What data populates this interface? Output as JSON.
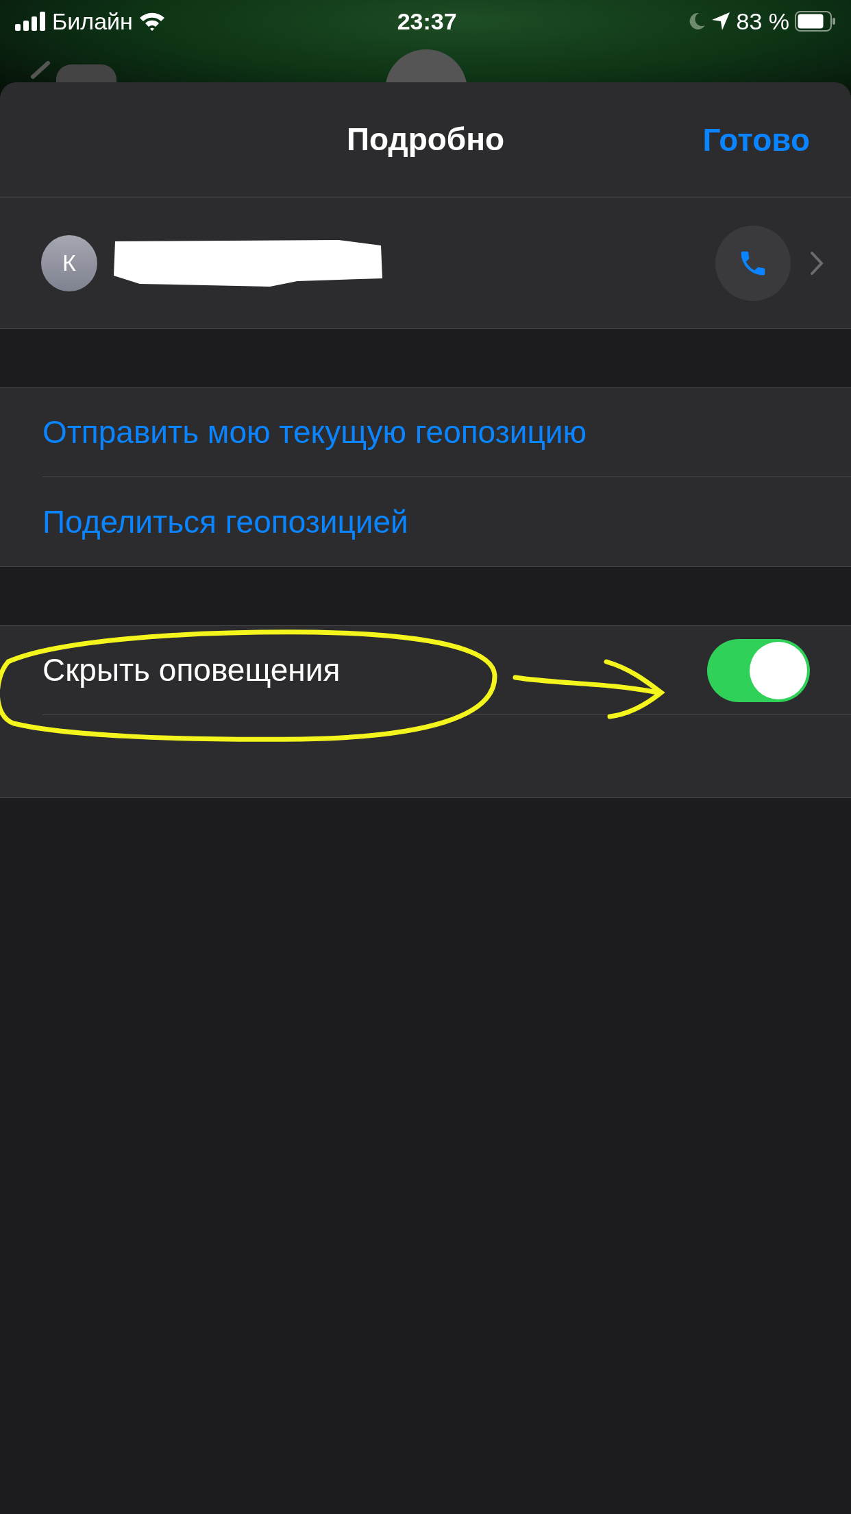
{
  "status_bar": {
    "carrier": "Билайн",
    "time": "23:37",
    "battery": "83 %"
  },
  "sheet": {
    "title": "Подробно",
    "done": "Готово"
  },
  "contact": {
    "initial": "К"
  },
  "actions": [
    {
      "label": "Отправить мою текущую геопозицию"
    },
    {
      "label": "Поделиться геопозицией"
    }
  ],
  "settings": [
    {
      "label": "Скрыть оповещения",
      "on": true
    }
  ]
}
